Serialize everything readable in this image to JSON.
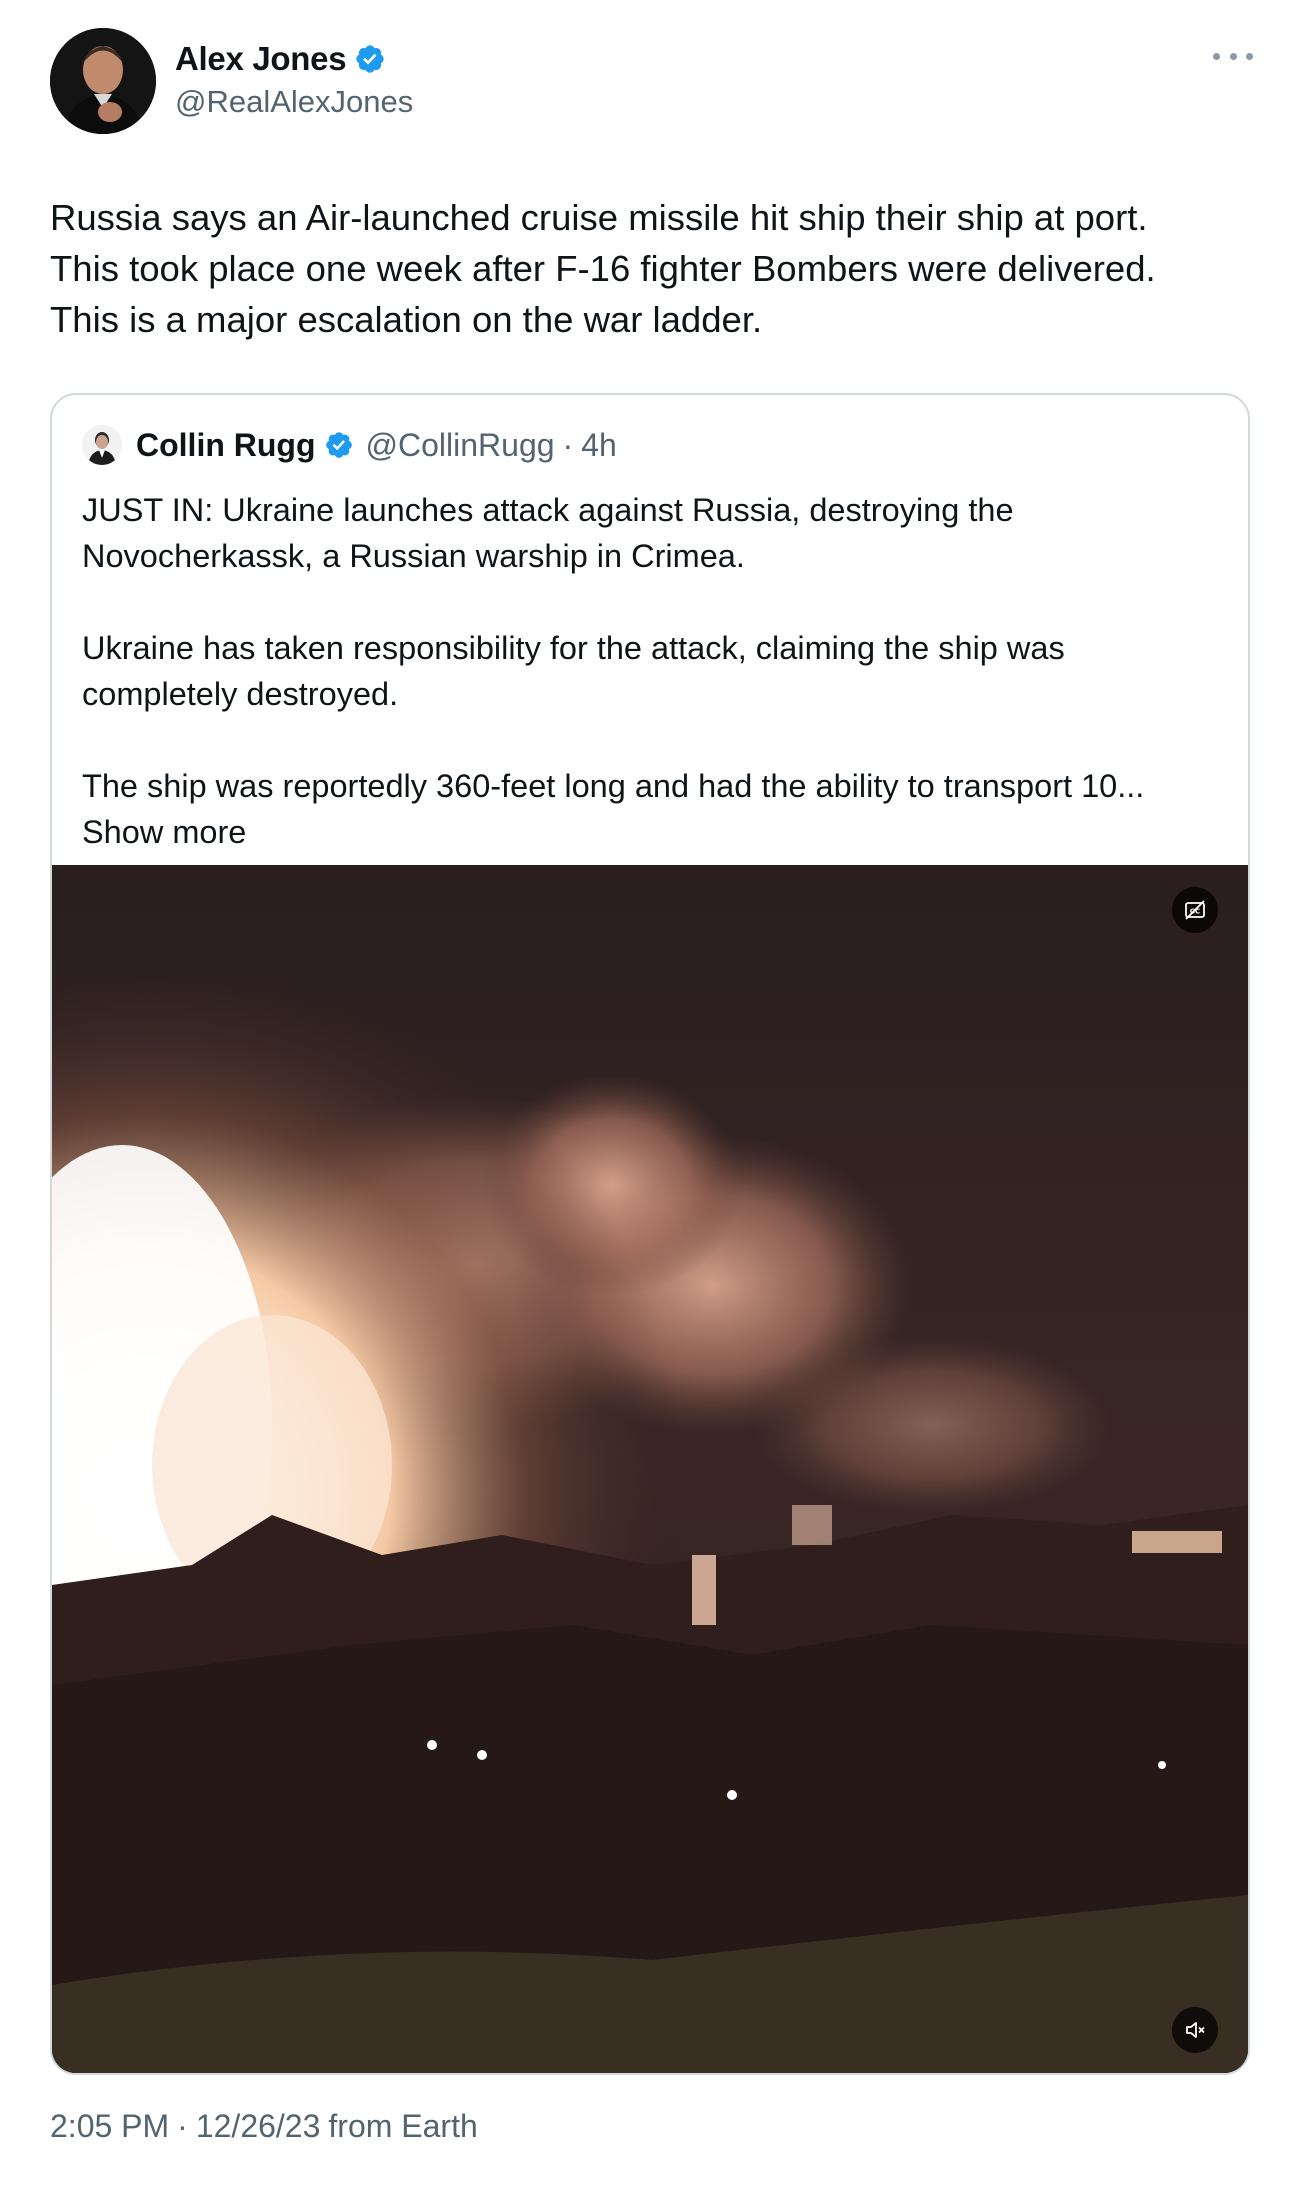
{
  "author": {
    "display_name": "Alex Jones",
    "handle": "@RealAlexJones",
    "verified": true
  },
  "tweet": {
    "text": "Russia says an Air-launched cruise missile hit ship their ship at port.\nThis took place one week after F-16 fighter Bombers were delivered.\nThis is a major escalation on the war ladder."
  },
  "quoted": {
    "display_name": "Collin Rugg",
    "handle": "@CollinRugg",
    "separator": "·",
    "time_ago": "4h",
    "paragraphs": [
      "JUST IN: Ukraine launches attack against Russia, destroying the Novocherkassk, a Russian warship in Crimea.",
      "Ukraine has taken responsibility for the attack, claiming the ship was completely destroyed.",
      "The ship was reportedly 360-feet long and had the ability to transport 10..."
    ],
    "show_more_label": "Show more",
    "media_icons": [
      "captions-icon",
      "muted-speaker-icon"
    ]
  },
  "footer": {
    "time": "2:05 PM",
    "separator": "·",
    "date": "12/26/23",
    "source": "from Earth"
  },
  "colors": {
    "verified_blue": "#1d9bf0",
    "secondary_text": "#536471",
    "border": "#cfd9de"
  }
}
